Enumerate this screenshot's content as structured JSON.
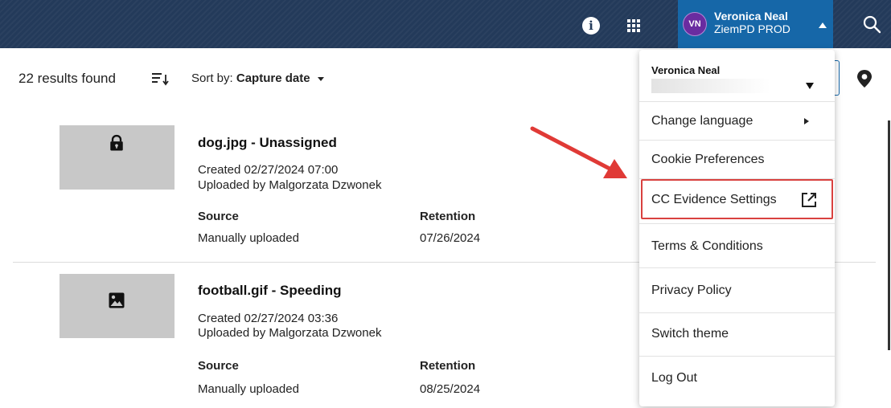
{
  "topbar": {
    "info_icon": "info-icon",
    "apps_icon": "apps-grid-icon",
    "user": {
      "initials": "VN",
      "name": "Veronica Neal",
      "environment": "ZiemPD PROD"
    },
    "search_icon": "search-icon",
    "colors": {
      "bar": "#233a5a",
      "user_chip": "#1667a8",
      "avatar": "#6a2ca0"
    }
  },
  "results": {
    "count_label": "22 results found",
    "sort_prefix": "Sort by:",
    "sort_value": "Capture date"
  },
  "items": [
    {
      "icon": "lock-icon",
      "title": "dog.jpg - Unassigned",
      "created": "Created 02/27/2024 07:00",
      "uploaded": "Uploaded by Malgorzata Dzwonek",
      "source_label": "Source",
      "source_value": "Manually uploaded",
      "retention_label": "Retention",
      "retention_value": "07/26/2024"
    },
    {
      "icon": "image-icon",
      "title": "football.gif - Speeding",
      "created": "Created 02/27/2024 03:36",
      "uploaded": "Uploaded by Malgorzata Dzwonek",
      "source_label": "Source",
      "source_value": "Manually uploaded",
      "retention_label": "Retention",
      "retention_value": "08/25/2024"
    }
  ],
  "menu": {
    "user_name": "Veronica Neal",
    "items": [
      {
        "label": "Change language"
      },
      {
        "label": "Cookie Preferences"
      },
      {
        "label": "CC Evidence Settings"
      },
      {
        "label": "Terms & Conditions"
      },
      {
        "label": "Privacy Policy"
      },
      {
        "label": "Switch theme"
      },
      {
        "label": "Log Out"
      }
    ],
    "highlight_color": "#d9413f"
  }
}
